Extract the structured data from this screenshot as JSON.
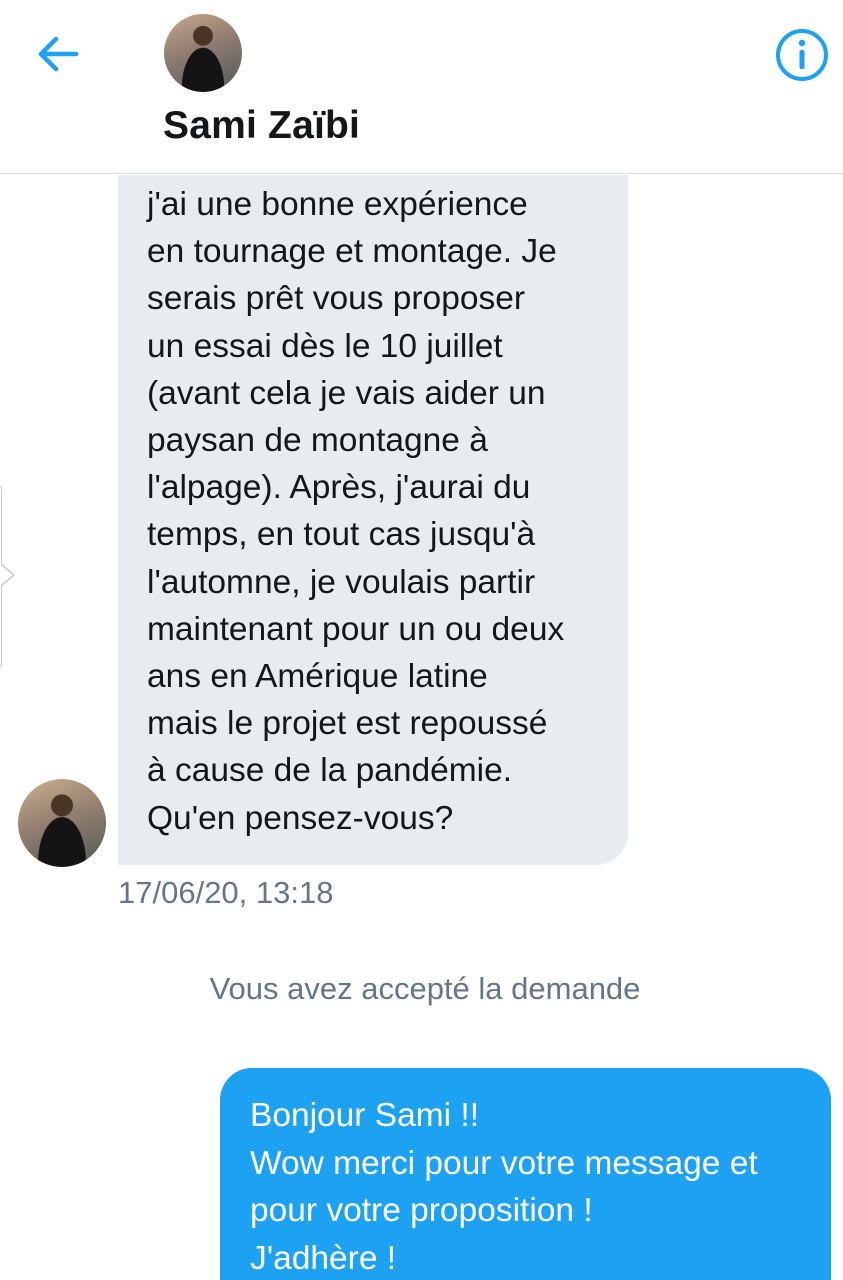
{
  "header": {
    "contact_name": "Sami Zaïbi",
    "back_icon": "arrow-left-icon",
    "info_icon": "info-icon",
    "accent_color": "#1DA1F2"
  },
  "conversation": {
    "incoming_message": {
      "text": "j'ai une bonne expérience\nen tournage et montage. Je\nserais prêt vous proposer\nun essai dès le 10 juillet\n(avant cela je vais aider un\npaysan de montagne à\nl'alpage). Après, j'aurai du\ntemps, en tout cas jusqu'à\nl'automne, je voulais partir\nmaintenant pour un ou deux\nans en Amérique latine\nmais le projet est repoussé\nà cause de la pandémie.\nQu'en pensez-vous?",
      "timestamp": "17/06/20, 13:18",
      "bubble_color": "#E6ECF0"
    },
    "system_notice": "Vous avez accepté la demande",
    "outgoing_message": {
      "text": "Bonjour Sami !!\nWow merci pour votre message et\npour votre proposition !\nJ'adhère !",
      "bubble_color": "#1DA1F2"
    }
  }
}
